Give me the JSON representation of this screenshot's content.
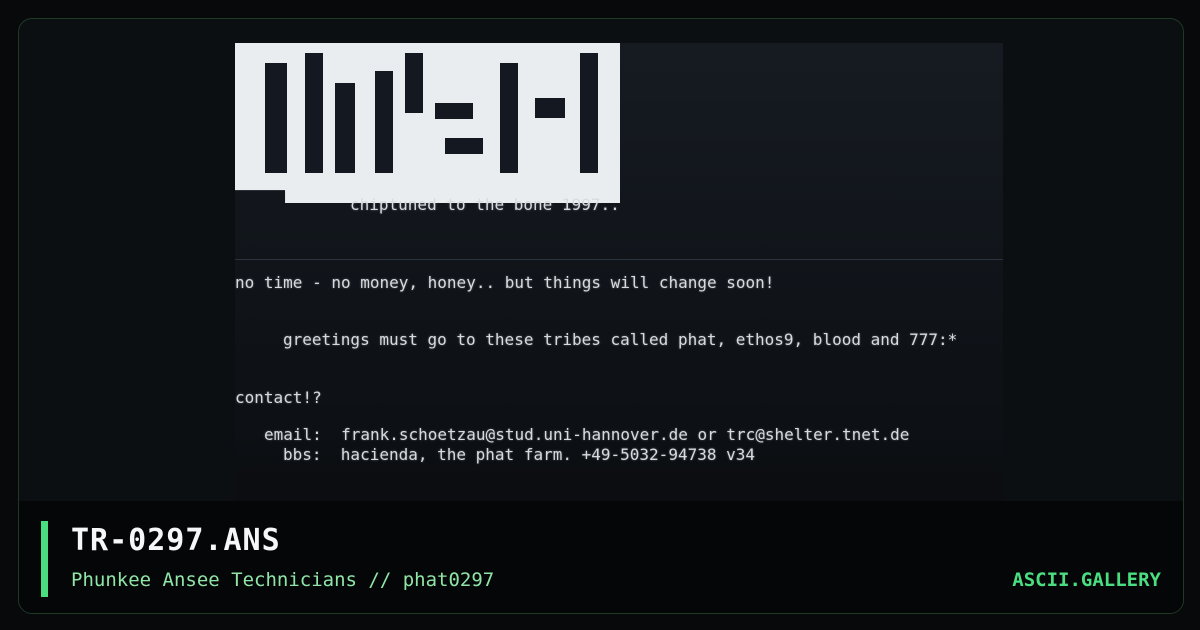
{
  "art": {
    "lines": [
      "chiptuned to the bone 1997..",
      "no time - no money, honey.. but things will change soon!",
      "greetings must go to these tribes called phat, ethos9, blood and 777:*",
      "contact!?",
      "email:  frank.schoetzau@stud.uni-hannover.de or trc@shelter.tnet.de",
      "bbs:  hacienda, the phat farm. +49-5032-94738 v34"
    ]
  },
  "footer": {
    "title": "TR-0297.ANS",
    "subtitle": "Phunkee Ansee Technicians // phat0297",
    "brand": "ASCII.GALLERY"
  },
  "colors": {
    "accent": "#4ade80",
    "subtitle": "#8fe5a8"
  }
}
